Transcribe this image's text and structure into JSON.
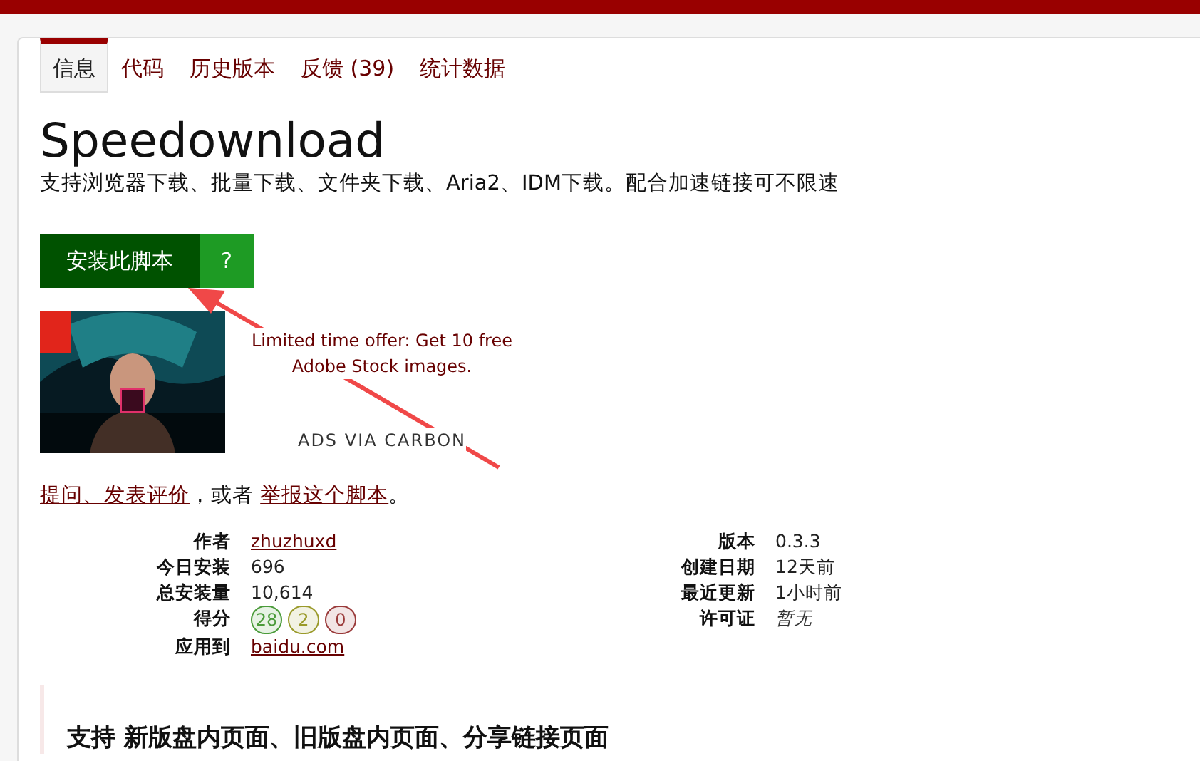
{
  "tabs": [
    {
      "label": "信息",
      "selected": true
    },
    {
      "label": "代码",
      "selected": false
    },
    {
      "label": "历史版本",
      "selected": false
    },
    {
      "label": "反馈 (39)",
      "selected": false
    },
    {
      "label": "统计数据",
      "selected": false
    }
  ],
  "script": {
    "title": "Speedownload",
    "description": "支持浏览器下载、批量下载、文件夹下载、Aria2、IDM下载。配合加速链接可不限速"
  },
  "install": {
    "label": "安装此脚本",
    "help": "?"
  },
  "ad": {
    "text": "Limited time offer: Get 10 free Adobe Stock images.",
    "via": "ADS VIA CARBON"
  },
  "feedback": {
    "link_1": "提问、发表评价",
    "middle": "，或者 ",
    "link_2": "举报这个脚本",
    "end": "。"
  },
  "info_left": [
    {
      "label": "作者",
      "kind": "link",
      "value": "zhuzhuxd"
    },
    {
      "label": "今日安装",
      "kind": "text",
      "value": "696"
    },
    {
      "label": "总安装量",
      "kind": "text",
      "value": "10,614"
    },
    {
      "label": "得分",
      "kind": "scores",
      "scores": [
        {
          "value": "28",
          "color": "#4a9b3a"
        },
        {
          "value": "2",
          "color": "#9a9a2a"
        },
        {
          "value": "0",
          "color": "#9a3a3a"
        }
      ]
    },
    {
      "label": "应用到",
      "kind": "link",
      "value": "baidu.com"
    }
  ],
  "info_right": [
    {
      "label": "版本",
      "kind": "text",
      "value": "0.3.3"
    },
    {
      "label": "创建日期",
      "kind": "text",
      "value": "12天前"
    },
    {
      "label": "最近更新",
      "kind": "text",
      "value": "1小时前"
    },
    {
      "label": "许可证",
      "kind": "italic",
      "value": "暂无"
    }
  ],
  "section_heading": "支持 新版盘内页面、旧版盘内页面、分享链接页面"
}
